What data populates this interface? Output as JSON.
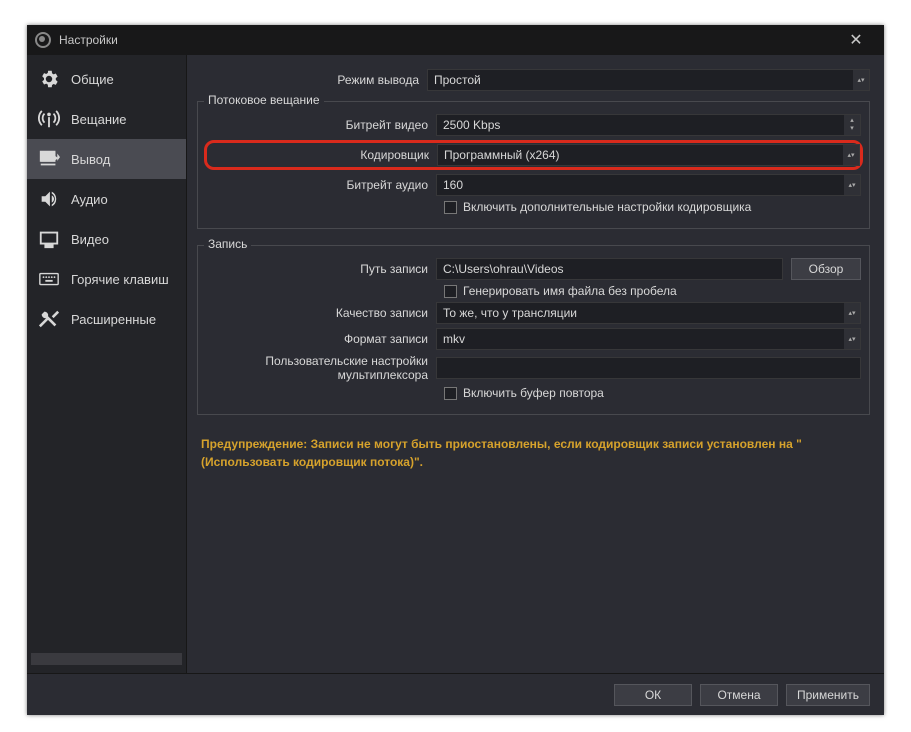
{
  "titlebar": {
    "title": "Настройки"
  },
  "sidebar": {
    "items": [
      {
        "label": "Общие"
      },
      {
        "label": "Вещание"
      },
      {
        "label": "Вывод"
      },
      {
        "label": "Аудио"
      },
      {
        "label": "Видео"
      },
      {
        "label": "Горячие клавиш"
      },
      {
        "label": "Расширенные"
      }
    ]
  },
  "output_mode": {
    "label": "Режим вывода",
    "value": "Простой"
  },
  "streaming": {
    "title": "Потоковое вещание",
    "video_bitrate": {
      "label": "Битрейт видео",
      "value": "2500 Kbps"
    },
    "encoder": {
      "label": "Кодировщик",
      "value": "Программный (x264)"
    },
    "audio_bitrate": {
      "label": "Битрейт аудио",
      "value": "160"
    },
    "advanced_checkbox": "Включить дополнительные настройки кодировщика"
  },
  "recording": {
    "title": "Запись",
    "path": {
      "label": "Путь записи",
      "value": "C:\\Users\\ohrau\\Videos",
      "browse": "Обзор"
    },
    "no_space_checkbox": "Генерировать имя файла без пробела",
    "quality": {
      "label": "Качество записи",
      "value": "То же, что у трансляции"
    },
    "format": {
      "label": "Формат записи",
      "value": "mkv"
    },
    "muxer": {
      "label": "Пользовательские настройки мультиплексора"
    },
    "replay_checkbox": "Включить буфер повтора"
  },
  "warning": "Предупреждение: Записи не могут быть приостановлены, если кодировщик записи установлен на \"(Использовать кодировщик потока)\".",
  "footer": {
    "ok": "ОК",
    "cancel": "Отмена",
    "apply": "Применить"
  }
}
